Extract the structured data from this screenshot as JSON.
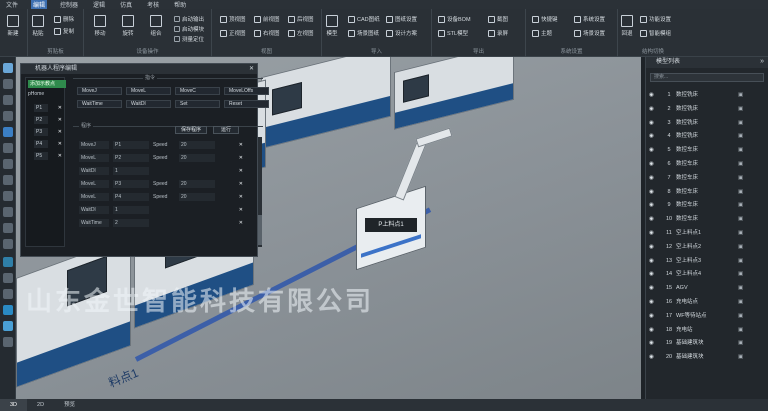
{
  "menu": [
    "文件",
    "编辑",
    "控制器",
    "逻辑",
    "仿真",
    "考核",
    "帮助"
  ],
  "menu_active_index": 1,
  "ribbon": {
    "new": {
      "label": "新建",
      "group": "新建"
    },
    "clipboard": {
      "paste": "粘贴",
      "delete": "删除",
      "copy": "复制",
      "group": "剪贴板"
    },
    "device": {
      "move": "移动",
      "rotate": "旋转",
      "group_btn": "组合",
      "check1": "启动输出",
      "check2": "启动模块",
      "check3": "测量定位",
      "group": "设备操作"
    },
    "view": {
      "v1": "顶视图",
      "v2": "前视图",
      "v3": "后视图",
      "v4": "正视图",
      "v5": "右视图",
      "v6": "左视图",
      "group": "视图"
    },
    "import": {
      "model": "模型",
      "cad": "CAD图纸",
      "scene": "场景图纸",
      "pic": "图纸设置",
      "design": "设计方案",
      "group": "导入"
    },
    "export": {
      "bom": "设备BOM",
      "stl": "STL模型",
      "shot": "截图",
      "record": "录屏",
      "group": "导出"
    },
    "system": {
      "shortcut": "快捷键",
      "theme": "主题",
      "sysset": "系统设置",
      "scene": "场景设置",
      "group": "系统设置"
    },
    "structure": {
      "s1": "功能设置",
      "s2": "智能模组",
      "back": "回退",
      "group": "结构切换"
    }
  },
  "panel": {
    "title": "机器人程序编辑",
    "close": "✕",
    "teach_head": "添加示教点",
    "teach_label": "pHome",
    "points": [
      "P1",
      "P2",
      "P3",
      "P4",
      "P5"
    ],
    "cmd_title": "指令",
    "cmds": [
      "MoveJ",
      "MoveL",
      "MoveC",
      "MoveLOffs",
      "WaitTime",
      "WaitDI",
      "Set",
      "Reset"
    ],
    "prog_title": "程序",
    "save_btn": "保存程序",
    "run_btn": "运行",
    "rows": [
      {
        "cmd": "MoveJ",
        "p": "P1",
        "speed_label": "Speed",
        "speed": "20"
      },
      {
        "cmd": "MoveL",
        "p": "P2",
        "speed_label": "Speed",
        "speed": "20"
      },
      {
        "cmd": "WaitDI",
        "p": "1",
        "speed_label": "",
        "speed": ""
      },
      {
        "cmd": "MoveL",
        "p": "P3",
        "speed_label": "Speed",
        "speed": "20"
      },
      {
        "cmd": "MoveL",
        "p": "P4",
        "speed_label": "Speed",
        "speed": "20"
      },
      {
        "cmd": "WaitDI",
        "p": "1",
        "speed_label": "",
        "speed": ""
      },
      {
        "cmd": "WaitTime",
        "p": "2",
        "speed_label": "",
        "speed": ""
      }
    ]
  },
  "watermark": "山东金世智能科技有限公司",
  "robot_label": "P上料点1",
  "floor_label": "料点1",
  "model_list": {
    "title": "模型列表",
    "search_placeholder": "搜索...",
    "items": [
      {
        "n": "1",
        "name": "数控铣床"
      },
      {
        "n": "2",
        "name": "数控铣床"
      },
      {
        "n": "3",
        "name": "数控铣床"
      },
      {
        "n": "4",
        "name": "数控铣床"
      },
      {
        "n": "5",
        "name": "数控车床"
      },
      {
        "n": "6",
        "name": "数控车床"
      },
      {
        "n": "7",
        "name": "数控车床"
      },
      {
        "n": "8",
        "name": "数控车床"
      },
      {
        "n": "9",
        "name": "数控车床"
      },
      {
        "n": "10",
        "name": "数控车床"
      },
      {
        "n": "11",
        "name": "空上料点1"
      },
      {
        "n": "12",
        "name": "空上料点2"
      },
      {
        "n": "13",
        "name": "空上料点3"
      },
      {
        "n": "14",
        "name": "空上料点4"
      },
      {
        "n": "15",
        "name": "AGV"
      },
      {
        "n": "16",
        "name": "充电站点"
      },
      {
        "n": "17",
        "name": "WF等待站点"
      },
      {
        "n": "18",
        "name": "充电站"
      },
      {
        "n": "19",
        "name": "基础建筑块"
      },
      {
        "n": "20",
        "name": "基础建筑块"
      }
    ]
  },
  "tabs": [
    "3D",
    "2D",
    "预览"
  ],
  "colors": {
    "accent": "#3d6fb0",
    "teach_green": "#2f8a4c",
    "track": "#3c5fa8"
  }
}
